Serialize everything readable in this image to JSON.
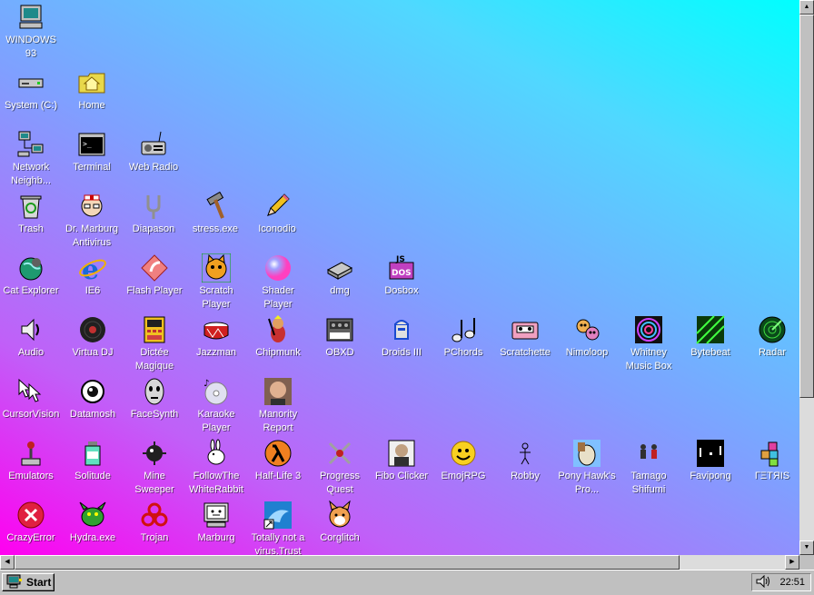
{
  "desktop": {
    "icons": [
      {
        "id": "windows93",
        "label": "WINDOWS 93",
        "icon": "computer-icon"
      },
      {
        "id": "system-c",
        "label": "System (C:)",
        "icon": "drive-icon"
      },
      {
        "id": "home",
        "label": "Home",
        "icon": "home-folder-icon"
      },
      {
        "id": "network",
        "label": "Network Neighb...",
        "icon": "network-icon"
      },
      {
        "id": "terminal",
        "label": "Terminal",
        "icon": "terminal-icon"
      },
      {
        "id": "webradio",
        "label": "Web Radio",
        "icon": "radio-icon"
      },
      {
        "id": "trash",
        "label": "Trash",
        "icon": "trash-icon"
      },
      {
        "id": "marburg-av",
        "label": "Dr. Marburg Antivirus",
        "icon": "doctor-icon"
      },
      {
        "id": "diapason",
        "label": "Diapason",
        "icon": "tuning-fork-icon"
      },
      {
        "id": "stress",
        "label": "stress.exe",
        "icon": "hammer-icon"
      },
      {
        "id": "iconodio",
        "label": "Iconodio",
        "icon": "pencil-icon"
      },
      {
        "id": "catexplorer",
        "label": "Cat Explorer",
        "icon": "cat-globe-icon"
      },
      {
        "id": "ie6",
        "label": "IE6",
        "icon": "ie-icon"
      },
      {
        "id": "flashplayer",
        "label": "Flash Player",
        "icon": "flash-icon"
      },
      {
        "id": "scratch",
        "label": "Scratch Player",
        "icon": "scratch-cat-icon"
      },
      {
        "id": "shader",
        "label": "Shader Player",
        "icon": "sphere-icon"
      },
      {
        "id": "dmg",
        "label": "dmg",
        "icon": "cartridge-icon"
      },
      {
        "id": "dosbox",
        "label": "Dosbox",
        "icon": "dosbox-icon"
      },
      {
        "id": "audio",
        "label": "Audio",
        "icon": "speaker-icon"
      },
      {
        "id": "virtuadj",
        "label": "Virtua DJ",
        "icon": "vinyl-icon"
      },
      {
        "id": "dictee",
        "label": "Dictée Magique",
        "icon": "dictee-icon"
      },
      {
        "id": "jazzman",
        "label": "Jazzman",
        "icon": "drum-icon"
      },
      {
        "id": "chipmunk",
        "label": "Chipmunk",
        "icon": "chipmunk-icon"
      },
      {
        "id": "obxd",
        "label": "OBXD",
        "icon": "synth-icon"
      },
      {
        "id": "droids",
        "label": "Droids III",
        "icon": "droid-icon"
      },
      {
        "id": "pchords",
        "label": "PChords",
        "icon": "note-icon"
      },
      {
        "id": "scratchette",
        "label": "Scratchette",
        "icon": "cassette-icon"
      },
      {
        "id": "nimoloop",
        "label": "Nimoloop",
        "icon": "creature-icon"
      },
      {
        "id": "whitney",
        "label": "Whitney Music Box",
        "icon": "spiral-icon"
      },
      {
        "id": "bytebeat",
        "label": "Bytebeat",
        "icon": "bytebeat-icon"
      },
      {
        "id": "radar",
        "label": "Radar",
        "icon": "radar-icon"
      },
      {
        "id": "cursorvision",
        "label": "CursorVision",
        "icon": "cursors-icon"
      },
      {
        "id": "datamosh",
        "label": "Datamosh",
        "icon": "eye-icon"
      },
      {
        "id": "facesynth",
        "label": "FaceSynth",
        "icon": "face-icon"
      },
      {
        "id": "karaoke",
        "label": "Karaoke Player",
        "icon": "cd-icon"
      },
      {
        "id": "manority",
        "label": "Manority Report",
        "icon": "portrait-icon"
      },
      {
        "id": "emulators",
        "label": "Emulators",
        "icon": "joystick-icon"
      },
      {
        "id": "solitude",
        "label": "Solitude",
        "icon": "bottle-icon"
      },
      {
        "id": "minesweeper",
        "label": "Mine Sweeper",
        "icon": "mine-icon"
      },
      {
        "id": "followrabbit",
        "label": "FollowThe WhiteRabbit",
        "icon": "rabbit-icon"
      },
      {
        "id": "halflife3",
        "label": "Half-Life 3",
        "icon": "lambda-icon"
      },
      {
        "id": "progressquest",
        "label": "Progress Quest",
        "icon": "swords-icon"
      },
      {
        "id": "fiboclicker",
        "label": "Fibo Clicker",
        "icon": "fibo-icon"
      },
      {
        "id": "emojirpg",
        "label": "EmojRPG",
        "icon": "smiley-icon"
      },
      {
        "id": "robby",
        "label": "Robby",
        "icon": "stickman-icon"
      },
      {
        "id": "ponyhawk",
        "label": "Pony Hawk's Pro...",
        "icon": "pony-icon"
      },
      {
        "id": "tamago",
        "label": "Tamago Shifumi",
        "icon": "fighters-icon"
      },
      {
        "id": "favipong",
        "label": "Favipong",
        "icon": "pong-icon"
      },
      {
        "id": "tetris",
        "label": "ΓΞΤЯΙS",
        "icon": "blocks-icon"
      },
      {
        "id": "crazyerror",
        "label": "CrazyError",
        "icon": "error-icon"
      },
      {
        "id": "hydra",
        "label": "Hydra.exe",
        "icon": "dragon-icon"
      },
      {
        "id": "trojan",
        "label": "Trojan",
        "icon": "biohazard-icon"
      },
      {
        "id": "marburg",
        "label": "Marburg",
        "icon": "monitor-face-icon"
      },
      {
        "id": "notavirus",
        "label": "Totally not a virus.Trust",
        "icon": "dolphin-shortcut-icon"
      },
      {
        "id": "corglitch",
        "label": "Corglitch",
        "icon": "corgi-icon"
      }
    ]
  },
  "taskbar": {
    "start_label": "Start",
    "start_icon": "windows93-logo-icon",
    "tray_icon": "volume-icon",
    "clock": "22:51"
  },
  "colors": {
    "gradient_magenta": "#ff00f0",
    "gradient_cyan": "#00ffff",
    "chrome_gray": "#c0c0c0"
  }
}
